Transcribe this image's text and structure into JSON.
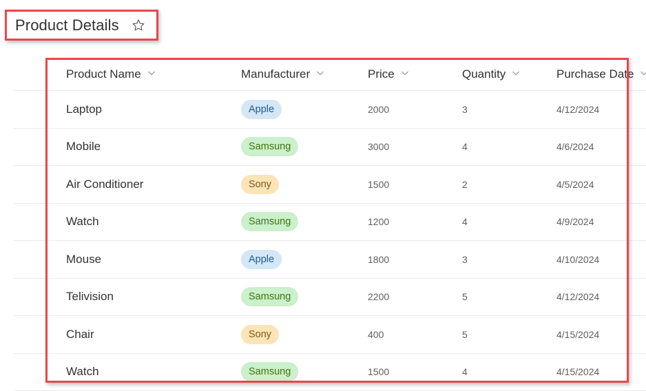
{
  "page": {
    "title": "Product Details",
    "favorite_icon": "star-outline-icon"
  },
  "table": {
    "columns": [
      {
        "label": "Product Name",
        "icon": "chevron-down-icon"
      },
      {
        "label": "Manufacturer",
        "icon": "chevron-down-icon"
      },
      {
        "label": "Price",
        "icon": "chevron-down-icon"
      },
      {
        "label": "Quantity",
        "icon": "chevron-down-icon"
      },
      {
        "label": "Purchase Date",
        "icon": "chevron-down-icon"
      }
    ],
    "rows": [
      {
        "name": "Laptop",
        "manufacturer": "Apple",
        "price": "2000",
        "quantity": "3",
        "date": "4/12/2024"
      },
      {
        "name": "Mobile",
        "manufacturer": "Samsung",
        "price": "3000",
        "quantity": "4",
        "date": "4/6/2024"
      },
      {
        "name": "Air Conditioner",
        "manufacturer": "Sony",
        "price": "1500",
        "quantity": "2",
        "date": "4/5/2024"
      },
      {
        "name": "Watch",
        "manufacturer": "Samsung",
        "price": "1200",
        "quantity": "4",
        "date": "4/9/2024"
      },
      {
        "name": "Mouse",
        "manufacturer": "Apple",
        "price": "1800",
        "quantity": "3",
        "date": "4/10/2024"
      },
      {
        "name": "Telivision",
        "manufacturer": "Samsung",
        "price": "2200",
        "quantity": "5",
        "date": "4/12/2024"
      },
      {
        "name": "Chair",
        "manufacturer": "Sony",
        "price": "400",
        "quantity": "5",
        "date": "4/15/2024"
      },
      {
        "name": "Watch",
        "manufacturer": "Samsung",
        "price": "1500",
        "quantity": "4",
        "date": "4/15/2024"
      }
    ]
  },
  "manufacturer_colors": {
    "Apple": {
      "bg": "#d4e7f6",
      "fg": "#1e5a8e"
    },
    "Samsung": {
      "bg": "#caf0cc",
      "fg": "#437406"
    },
    "Sony": {
      "bg": "#fce4b6",
      "fg": "#7a5a15"
    }
  },
  "annotation_color": "#e8474c"
}
